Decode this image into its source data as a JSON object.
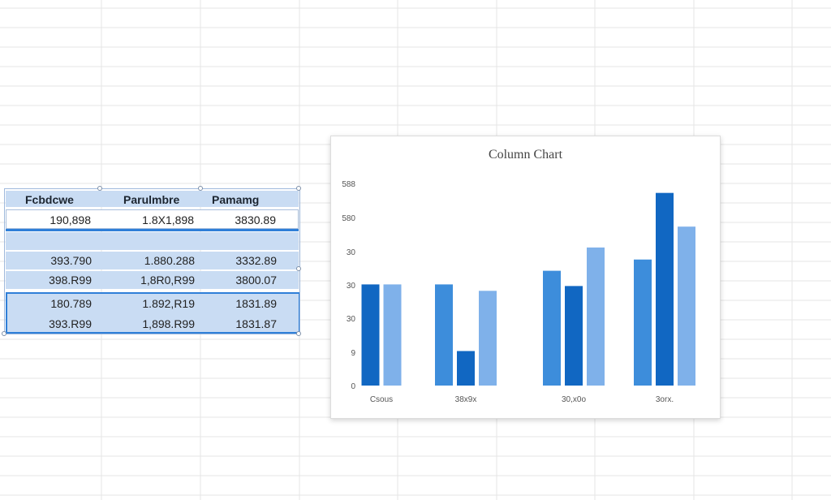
{
  "table": {
    "headers": [
      "Fcbdcwe",
      "Parulmbre",
      "Pamamg"
    ],
    "rows": [
      [
        "190,898",
        "1.8X1,898",
        "3830.89"
      ],
      [
        "",
        "",
        ""
      ],
      [
        "393.790",
        "1.880.288",
        "3332.89"
      ],
      [
        "398.R99",
        "1,8R0,R99",
        "3800.07"
      ],
      [
        "180.789",
        "1.892,R19",
        "1831.89"
      ],
      [
        "393.R99",
        "1,898.R99",
        "1831.87"
      ]
    ]
  },
  "colors": {
    "table_fill": "#c9dcf3",
    "selection": "#2f7fd8",
    "series_a": "#3d8ddb",
    "series_b": "#1167c2",
    "series_c": "#7fb1ea"
  },
  "chart_data": {
    "type": "bar",
    "title": "Column Chart",
    "xlabel": "",
    "ylabel": "",
    "y_tick_labels": [
      "0",
      "9",
      "30",
      "30",
      "30",
      "580",
      "588"
    ],
    "categories": [
      "Csous",
      "38x9x",
      "30,x0o",
      "3orx."
    ],
    "series": [
      {
        "values": [
          null,
          126,
          143,
          157
        ],
        "color": "#3d8ddb"
      },
      {
        "values": [
          126,
          43,
          124,
          240
        ],
        "color": "#1167c2"
      },
      {
        "values": [
          126,
          118,
          172,
          198
        ],
        "color": "#7fb1ea"
      }
    ],
    "ylim": [
      0,
      270
    ],
    "grid": false,
    "legend": "none"
  }
}
